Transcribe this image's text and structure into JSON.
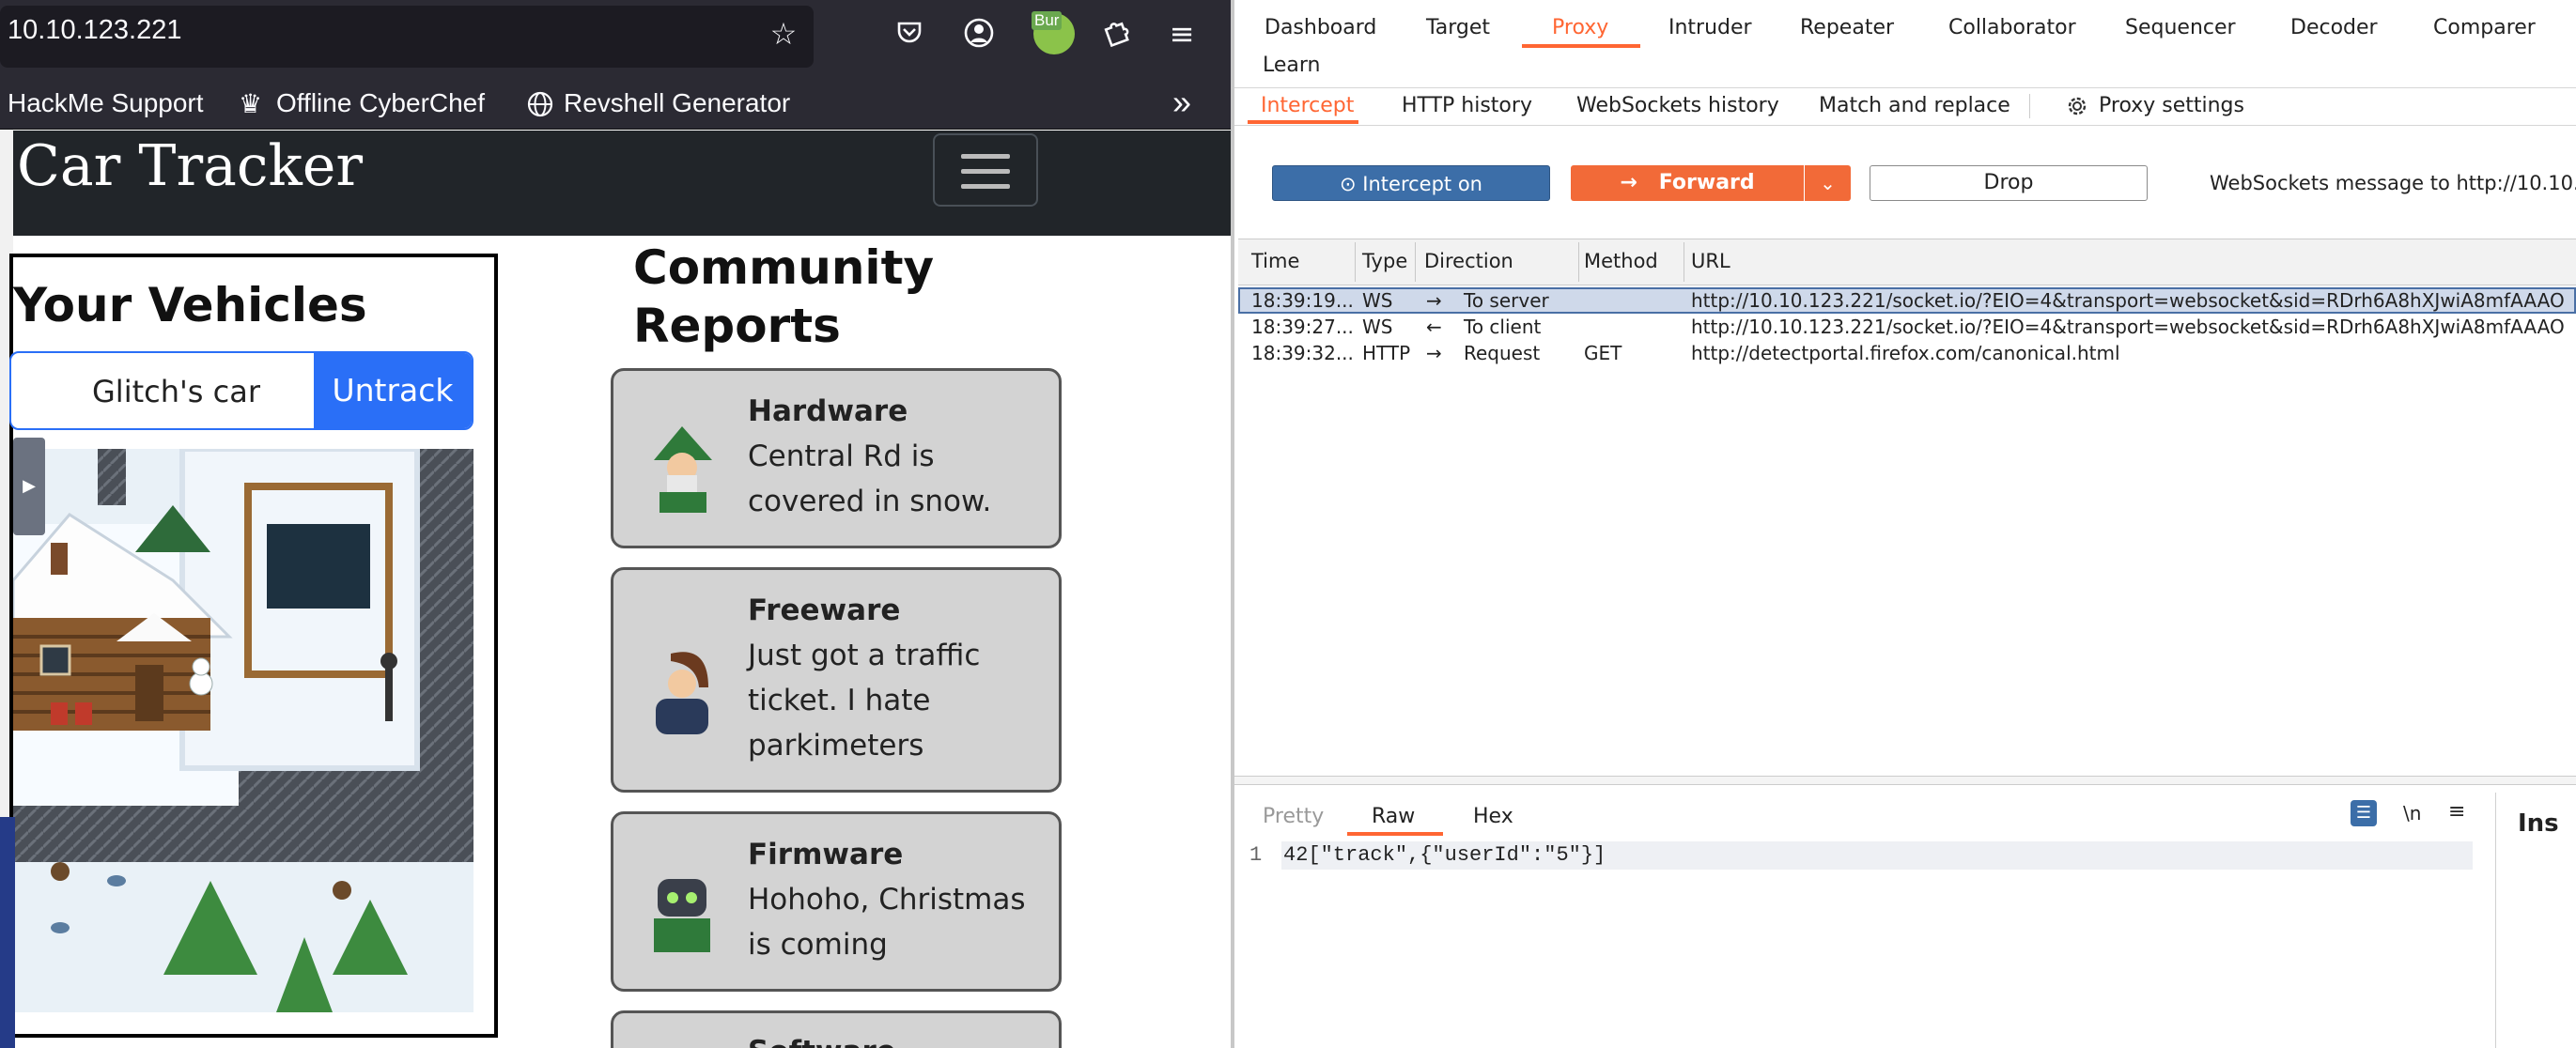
{
  "browser": {
    "url": "10.10.123.221",
    "toolbar_icons": [
      "star-icon",
      "pocket-icon",
      "account-icon",
      "extension-badge-icon",
      "extensions-icon",
      "menu-icon"
    ],
    "extension_badge": "Bur",
    "bookmarks": [
      {
        "label": "HackMe Support",
        "icon": "none"
      },
      {
        "label": "Offline CyberChef",
        "icon": "chef-icon"
      },
      {
        "label": "Revshell Generator",
        "icon": "globe-icon"
      }
    ],
    "overflow": "»"
  },
  "site": {
    "brand": "Car Tracker",
    "vehicles_title": "Your Vehicles",
    "vehicle_name": "Glitch's car",
    "untrack_label": "Untrack",
    "community_title_line1": "Community",
    "community_title_line2": "Reports",
    "reports": [
      {
        "name": "Hardware",
        "text": "Central Rd is covered in snow."
      },
      {
        "name": "Freeware",
        "text": "Just got a traffic ticket. I hate parkimeters"
      },
      {
        "name": "Firmware",
        "text": "Hohoho, Christmas is coming"
      },
      {
        "name": "Software",
        "text": ""
      }
    ]
  },
  "burp": {
    "main_tabs": [
      "Dashboard",
      "Target",
      "Proxy",
      "Intruder",
      "Repeater",
      "Collaborator",
      "Sequencer",
      "Decoder",
      "Comparer",
      "Learn"
    ],
    "active_main_tab": "Proxy",
    "sub_tabs": [
      "Intercept",
      "HTTP history",
      "WebSockets history",
      "Match and replace",
      "Proxy settings"
    ],
    "active_sub_tab": "Intercept",
    "intercept_label": "Intercept on",
    "forward_label": "Forward",
    "drop_label": "Drop",
    "ws_message": "WebSockets message to http://10.10.",
    "table_headers": [
      "Time",
      "Type",
      "Direction",
      "Method",
      "URL"
    ],
    "rows": [
      {
        "time": "18:39:19...",
        "type": "WS",
        "arrow": "→",
        "direction": "To server",
        "method": "",
        "url": "http://10.10.123.221/socket.io/?EIO=4&transport=websocket&sid=RDrh6A8hXJwiA8mfAAAO",
        "selected": true
      },
      {
        "time": "18:39:27...",
        "type": "WS",
        "arrow": "←",
        "direction": "To client",
        "method": "",
        "url": "http://10.10.123.221/socket.io/?EIO=4&transport=websocket&sid=RDrh6A8hXJwiA8mfAAAO",
        "selected": false
      },
      {
        "time": "18:39:32...",
        "type": "HTTP",
        "arrow": "→",
        "direction": "Request",
        "method": "GET",
        "url": "http://detectportal.firefox.com/canonical.html",
        "selected": false
      }
    ],
    "editor_tabs": [
      "Pretty",
      "Raw",
      "Hex"
    ],
    "active_editor_tab": "Raw",
    "editor_line_number": "1",
    "editor_content": "42[\"track\",{\"userId\":\"5\"}]",
    "newline_toggle": "\\n",
    "inspector_label": "Ins",
    "colors": {
      "accent": "#ff6633",
      "intercept": "#3c6ea8",
      "forward": "#f26a38",
      "selected_row": "#cfd9ea"
    }
  }
}
